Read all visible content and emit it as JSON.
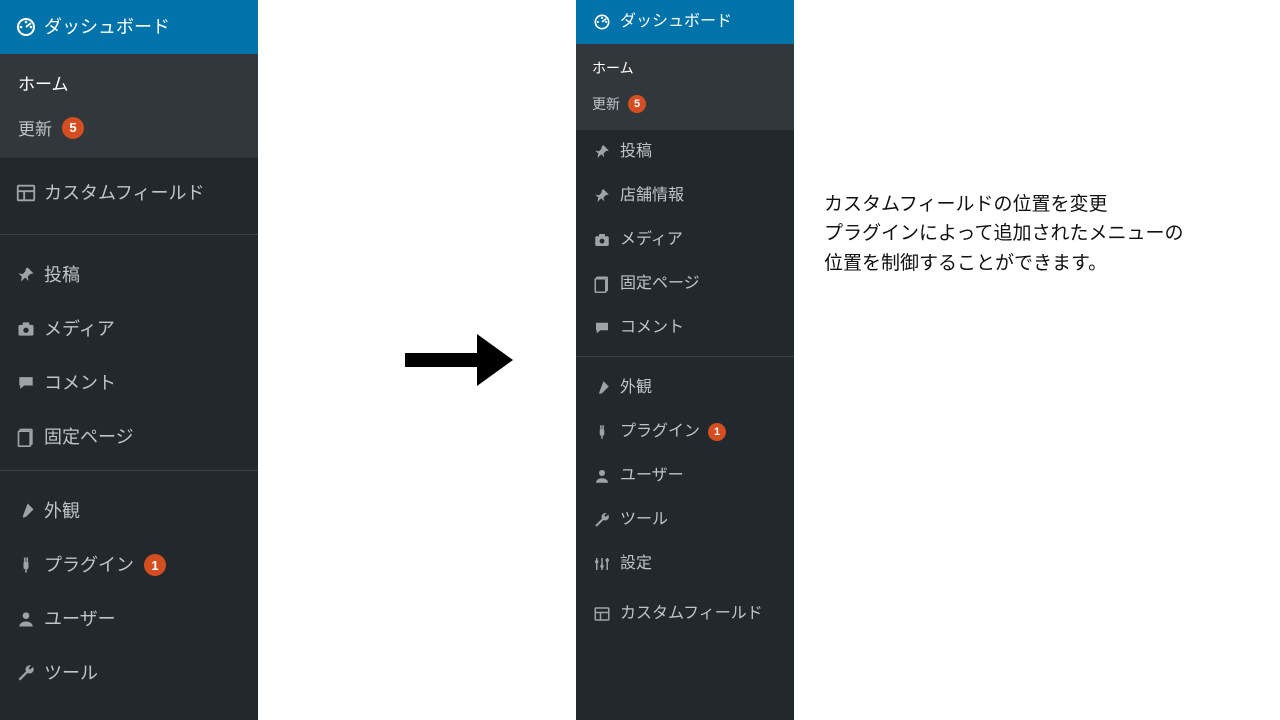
{
  "left_menu": {
    "dashboard": "ダッシュボード",
    "sub": {
      "home": "ホーム",
      "updates": "更新",
      "updates_badge": "5"
    },
    "items": [
      {
        "label": "カスタムフィールド",
        "icon": "layout"
      },
      {
        "label": "投稿",
        "icon": "pin"
      },
      {
        "label": "メディア",
        "icon": "camera"
      },
      {
        "label": "コメント",
        "icon": "comment"
      },
      {
        "label": "固定ページ",
        "icon": "page"
      },
      {
        "label": "外観",
        "icon": "brush"
      },
      {
        "label": "プラグイン",
        "icon": "plug",
        "badge": "1"
      },
      {
        "label": "ユーザー",
        "icon": "user"
      },
      {
        "label": "ツール",
        "icon": "wrench"
      }
    ]
  },
  "right_menu": {
    "dashboard": "ダッシュボード",
    "sub": {
      "home": "ホーム",
      "updates": "更新",
      "updates_badge": "5"
    },
    "items": [
      {
        "label": "投稿",
        "icon": "pin"
      },
      {
        "label": "店舗情報",
        "icon": "pin"
      },
      {
        "label": "メディア",
        "icon": "camera"
      },
      {
        "label": "固定ページ",
        "icon": "page"
      },
      {
        "label": "コメント",
        "icon": "comment"
      },
      {
        "label": "外観",
        "icon": "brush"
      },
      {
        "label": "プラグイン",
        "icon": "plug",
        "badge": "1"
      },
      {
        "label": "ユーザー",
        "icon": "user"
      },
      {
        "label": "ツール",
        "icon": "wrench"
      },
      {
        "label": "設定",
        "icon": "sliders"
      },
      {
        "label": "カスタムフィールド",
        "icon": "layout"
      }
    ]
  },
  "description": {
    "line1": "カスタムフィールドの位置を変更",
    "line2": "プラグインによって追加されたメニューの",
    "line3": "位置を制御することができます。"
  }
}
